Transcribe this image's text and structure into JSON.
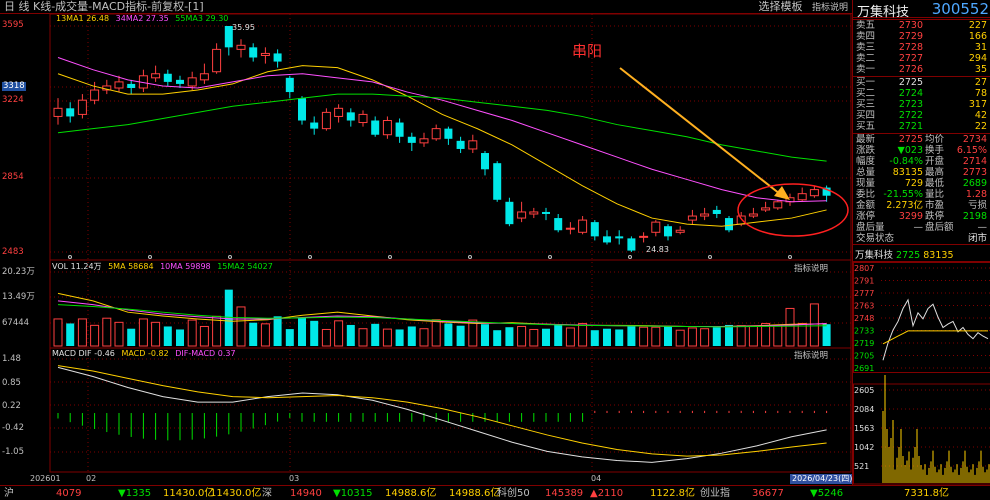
{
  "header": {
    "left": "日  线 K线-成交量-MACD指标-前复权-[1]",
    "select_template": "选择模板",
    "indicator_explain": "指标说明"
  },
  "main_chart": {
    "ma_legend": [
      {
        "text": "13MA1 26.48",
        "color": "#ffd000"
      },
      {
        "text": "34MA2 27.35",
        "color": "#ff50ff"
      },
      {
        "text": "55MA3 29.30",
        "color": "#00e000"
      }
    ],
    "y_ticks": [
      "3595",
      "3318",
      "3224",
      "2854",
      "2483"
    ],
    "high_label": "35.95",
    "low_label": "24.83",
    "annotation": "串阳"
  },
  "volume_chart": {
    "legend": [
      {
        "text": "VOL 11.24万",
        "color": "#e0e0e0"
      },
      {
        "text": "5MA 58684",
        "color": "#ffd000"
      },
      {
        "text": "10MA 59898",
        "color": "#ff50ff"
      },
      {
        "text": "15MA2 54027",
        "color": "#00e000"
      }
    ],
    "y_ticks": [
      "20.23万",
      "13.49万",
      "67444"
    ],
    "explain": "指标说明"
  },
  "macd_chart": {
    "legend": [
      {
        "text": "MACD DIF -0.46",
        "color": "#e0e0e0"
      },
      {
        "text": "MACD -0.82",
        "color": "#ffd000"
      },
      {
        "text": "DIF-MACD 0.37",
        "color": "#ff50ff"
      }
    ],
    "y_ticks": [
      "1.48",
      "0.85",
      "0.22",
      "-0.42",
      "-1.05"
    ],
    "explain": "指标说明"
  },
  "x_axis": {
    "labels": [
      "202601",
      "02",
      "03",
      "04"
    ],
    "date_box": "2026/04/23(四)"
  },
  "right_panel": {
    "name": "万集科技",
    "code": "300552",
    "sells": [
      {
        "label": "卖五",
        "price": "2730",
        "vol": "227"
      },
      {
        "label": "卖四",
        "price": "2729",
        "vol": "166"
      },
      {
        "label": "卖三",
        "price": "2728",
        "vol": "31"
      },
      {
        "label": "卖二",
        "price": "2727",
        "vol": "294"
      },
      {
        "label": "卖一",
        "price": "2726",
        "vol": "35"
      }
    ],
    "buys": [
      {
        "label": "买一",
        "price": "2725",
        "vol": "27"
      },
      {
        "label": "买二",
        "price": "2724",
        "vol": "78"
      },
      {
        "label": "买三",
        "price": "2723",
        "vol": "317"
      },
      {
        "label": "买四",
        "price": "2722",
        "vol": "42"
      },
      {
        "label": "买五",
        "price": "2721",
        "vol": "22"
      }
    ],
    "stats": [
      [
        "最新",
        "2725",
        "均价",
        "2734"
      ],
      [
        "涨跌",
        "▼023",
        "换手",
        "6.15%"
      ],
      [
        "幅度",
        "-0.84%",
        "开盘",
        "2714"
      ],
      [
        "总量",
        "83135",
        "最高",
        "2773"
      ],
      [
        "现量",
        "729",
        "最低",
        "2689"
      ],
      [
        "委比",
        "-21.55%",
        "量比",
        "1.28"
      ],
      [
        "金额",
        "2.273亿",
        "市盈",
        "亏损"
      ],
      [
        "涨停",
        "3299",
        "跌停",
        "2198"
      ],
      [
        "盘后量",
        "—",
        "盘后额",
        "—"
      ],
      [
        "交易状态",
        "",
        "",
        "闭市"
      ]
    ],
    "mini_title": {
      "name": "万集科技",
      "price": "2725",
      "vol": "83135"
    },
    "mini_y_ticks": [
      "2807",
      "2791",
      "2777",
      "2763",
      "2748",
      "2733",
      "2719",
      "2705",
      "2691"
    ],
    "mini_vol_ticks": [
      "2605",
      "2084",
      "1563",
      "1042",
      "521"
    ]
  },
  "bottom_bar": {
    "items": [
      {
        "text": "沪",
        "color": "#c0c0c0"
      },
      {
        "text": "4079",
        "color": "#ff4040"
      },
      {
        "text": "▼1335",
        "color": "#00e000"
      },
      {
        "text": "11430.0亿",
        "color": "#ffd000"
      },
      {
        "text": "11430.0亿",
        "color": "#ffd000"
      },
      {
        "text": "深",
        "color": "#c0c0c0"
      },
      {
        "text": "14940",
        "color": "#ff4040"
      },
      {
        "text": "▼10315",
        "color": "#00e000"
      },
      {
        "text": "14988.6亿",
        "color": "#ffd000"
      },
      {
        "text": "14988.6亿",
        "color": "#ffd000"
      },
      {
        "text": "科创50",
        "color": "#c0c0c0"
      },
      {
        "text": "145389",
        "color": "#ff4040"
      },
      {
        "text": "▲2110",
        "color": "#ff4040"
      },
      {
        "text": "1122.8亿",
        "color": "#ffd000"
      },
      {
        "text": "创业指",
        "color": "#c0c0c0"
      },
      {
        "text": "36677",
        "color": "#ff4040"
      },
      {
        "text": "▼5246",
        "color": "#00e000"
      },
      {
        "text": "7331.8亿",
        "color": "#ffd000"
      }
    ]
  },
  "colors": {
    "up": "#ff4040",
    "down": "#00e8e8",
    "ma13": "#ffd000",
    "ma34": "#ff50ff",
    "ma55": "#00e000",
    "grid": "#800000"
  }
}
